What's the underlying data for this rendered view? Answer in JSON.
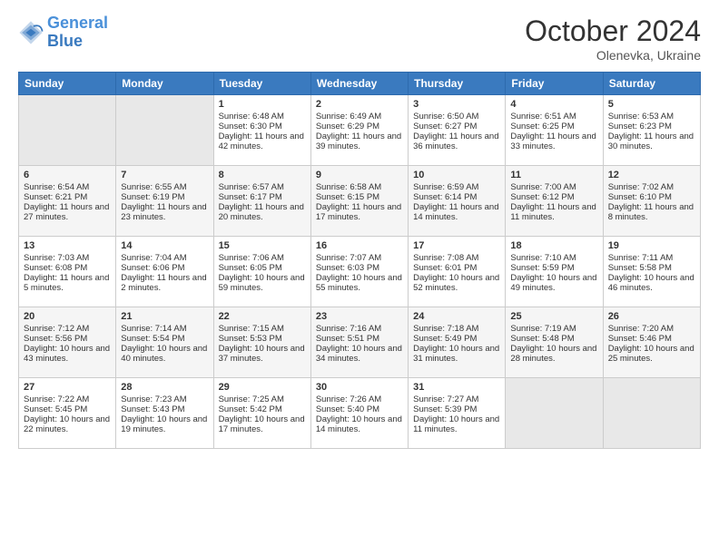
{
  "header": {
    "logo_line1": "General",
    "logo_line2": "Blue",
    "month": "October 2024",
    "location": "Olenevka, Ukraine"
  },
  "days_of_week": [
    "Sunday",
    "Monday",
    "Tuesday",
    "Wednesday",
    "Thursday",
    "Friday",
    "Saturday"
  ],
  "weeks": [
    [
      {
        "day": "",
        "info": ""
      },
      {
        "day": "",
        "info": ""
      },
      {
        "day": "1",
        "sunrise": "Sunrise: 6:48 AM",
        "sunset": "Sunset: 6:30 PM",
        "daylight": "Daylight: 11 hours and 42 minutes."
      },
      {
        "day": "2",
        "sunrise": "Sunrise: 6:49 AM",
        "sunset": "Sunset: 6:29 PM",
        "daylight": "Daylight: 11 hours and 39 minutes."
      },
      {
        "day": "3",
        "sunrise": "Sunrise: 6:50 AM",
        "sunset": "Sunset: 6:27 PM",
        "daylight": "Daylight: 11 hours and 36 minutes."
      },
      {
        "day": "4",
        "sunrise": "Sunrise: 6:51 AM",
        "sunset": "Sunset: 6:25 PM",
        "daylight": "Daylight: 11 hours and 33 minutes."
      },
      {
        "day": "5",
        "sunrise": "Sunrise: 6:53 AM",
        "sunset": "Sunset: 6:23 PM",
        "daylight": "Daylight: 11 hours and 30 minutes."
      }
    ],
    [
      {
        "day": "6",
        "sunrise": "Sunrise: 6:54 AM",
        "sunset": "Sunset: 6:21 PM",
        "daylight": "Daylight: 11 hours and 27 minutes."
      },
      {
        "day": "7",
        "sunrise": "Sunrise: 6:55 AM",
        "sunset": "Sunset: 6:19 PM",
        "daylight": "Daylight: 11 hours and 23 minutes."
      },
      {
        "day": "8",
        "sunrise": "Sunrise: 6:57 AM",
        "sunset": "Sunset: 6:17 PM",
        "daylight": "Daylight: 11 hours and 20 minutes."
      },
      {
        "day": "9",
        "sunrise": "Sunrise: 6:58 AM",
        "sunset": "Sunset: 6:15 PM",
        "daylight": "Daylight: 11 hours and 17 minutes."
      },
      {
        "day": "10",
        "sunrise": "Sunrise: 6:59 AM",
        "sunset": "Sunset: 6:14 PM",
        "daylight": "Daylight: 11 hours and 14 minutes."
      },
      {
        "day": "11",
        "sunrise": "Sunrise: 7:00 AM",
        "sunset": "Sunset: 6:12 PM",
        "daylight": "Daylight: 11 hours and 11 minutes."
      },
      {
        "day": "12",
        "sunrise": "Sunrise: 7:02 AM",
        "sunset": "Sunset: 6:10 PM",
        "daylight": "Daylight: 11 hours and 8 minutes."
      }
    ],
    [
      {
        "day": "13",
        "sunrise": "Sunrise: 7:03 AM",
        "sunset": "Sunset: 6:08 PM",
        "daylight": "Daylight: 11 hours and 5 minutes."
      },
      {
        "day": "14",
        "sunrise": "Sunrise: 7:04 AM",
        "sunset": "Sunset: 6:06 PM",
        "daylight": "Daylight: 11 hours and 2 minutes."
      },
      {
        "day": "15",
        "sunrise": "Sunrise: 7:06 AM",
        "sunset": "Sunset: 6:05 PM",
        "daylight": "Daylight: 10 hours and 59 minutes."
      },
      {
        "day": "16",
        "sunrise": "Sunrise: 7:07 AM",
        "sunset": "Sunset: 6:03 PM",
        "daylight": "Daylight: 10 hours and 55 minutes."
      },
      {
        "day": "17",
        "sunrise": "Sunrise: 7:08 AM",
        "sunset": "Sunset: 6:01 PM",
        "daylight": "Daylight: 10 hours and 52 minutes."
      },
      {
        "day": "18",
        "sunrise": "Sunrise: 7:10 AM",
        "sunset": "Sunset: 5:59 PM",
        "daylight": "Daylight: 10 hours and 49 minutes."
      },
      {
        "day": "19",
        "sunrise": "Sunrise: 7:11 AM",
        "sunset": "Sunset: 5:58 PM",
        "daylight": "Daylight: 10 hours and 46 minutes."
      }
    ],
    [
      {
        "day": "20",
        "sunrise": "Sunrise: 7:12 AM",
        "sunset": "Sunset: 5:56 PM",
        "daylight": "Daylight: 10 hours and 43 minutes."
      },
      {
        "day": "21",
        "sunrise": "Sunrise: 7:14 AM",
        "sunset": "Sunset: 5:54 PM",
        "daylight": "Daylight: 10 hours and 40 minutes."
      },
      {
        "day": "22",
        "sunrise": "Sunrise: 7:15 AM",
        "sunset": "Sunset: 5:53 PM",
        "daylight": "Daylight: 10 hours and 37 minutes."
      },
      {
        "day": "23",
        "sunrise": "Sunrise: 7:16 AM",
        "sunset": "Sunset: 5:51 PM",
        "daylight": "Daylight: 10 hours and 34 minutes."
      },
      {
        "day": "24",
        "sunrise": "Sunrise: 7:18 AM",
        "sunset": "Sunset: 5:49 PM",
        "daylight": "Daylight: 10 hours and 31 minutes."
      },
      {
        "day": "25",
        "sunrise": "Sunrise: 7:19 AM",
        "sunset": "Sunset: 5:48 PM",
        "daylight": "Daylight: 10 hours and 28 minutes."
      },
      {
        "day": "26",
        "sunrise": "Sunrise: 7:20 AM",
        "sunset": "Sunset: 5:46 PM",
        "daylight": "Daylight: 10 hours and 25 minutes."
      }
    ],
    [
      {
        "day": "27",
        "sunrise": "Sunrise: 7:22 AM",
        "sunset": "Sunset: 5:45 PM",
        "daylight": "Daylight: 10 hours and 22 minutes."
      },
      {
        "day": "28",
        "sunrise": "Sunrise: 7:23 AM",
        "sunset": "Sunset: 5:43 PM",
        "daylight": "Daylight: 10 hours and 19 minutes."
      },
      {
        "day": "29",
        "sunrise": "Sunrise: 7:25 AM",
        "sunset": "Sunset: 5:42 PM",
        "daylight": "Daylight: 10 hours and 17 minutes."
      },
      {
        "day": "30",
        "sunrise": "Sunrise: 7:26 AM",
        "sunset": "Sunset: 5:40 PM",
        "daylight": "Daylight: 10 hours and 14 minutes."
      },
      {
        "day": "31",
        "sunrise": "Sunrise: 7:27 AM",
        "sunset": "Sunset: 5:39 PM",
        "daylight": "Daylight: 10 hours and 11 minutes."
      },
      {
        "day": "",
        "info": ""
      },
      {
        "day": "",
        "info": ""
      }
    ]
  ]
}
